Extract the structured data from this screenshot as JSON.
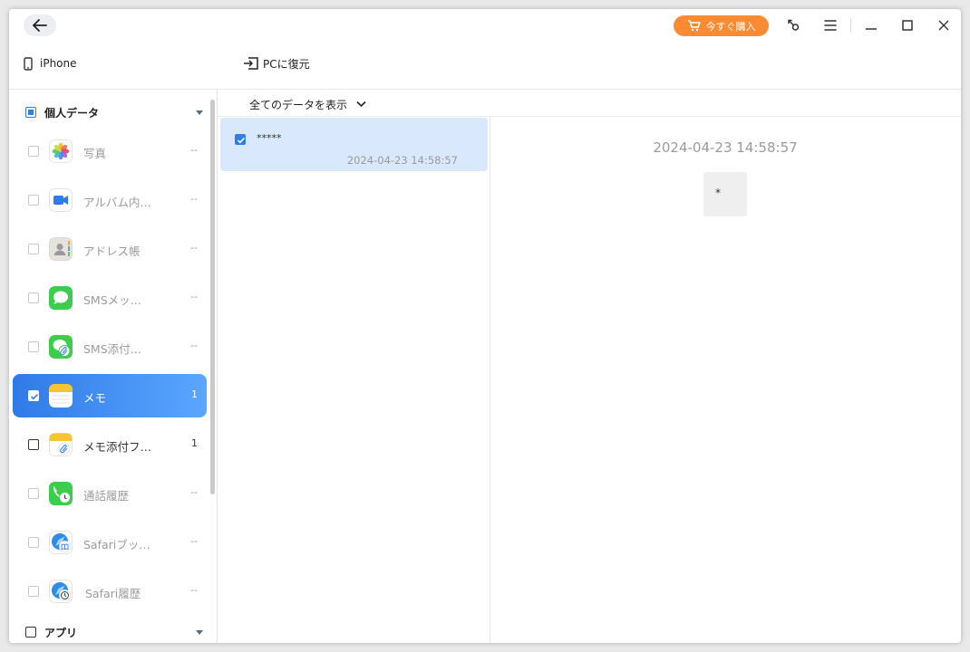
{
  "titlebar": {
    "buy_label": "今すぐ購入"
  },
  "toolbar": {
    "device_name": "iPhone",
    "restore_label": "PCに復元"
  },
  "sidebar": {
    "group_personal": "個人データ",
    "group_apps": "アプリ",
    "items": [
      {
        "label": "写真",
        "count": "--",
        "icon": "photos-icon"
      },
      {
        "label": "アルバム内…",
        "count": "--",
        "icon": "video-camera-icon"
      },
      {
        "label": "アドレス帳",
        "count": "--",
        "icon": "contacts-icon"
      },
      {
        "label": "SMSメッ…",
        "count": "--",
        "icon": "messages-icon"
      },
      {
        "label": "SMS添付…",
        "count": "--",
        "icon": "message-attachment-icon"
      },
      {
        "label": "メモ",
        "count": "1",
        "icon": "notes-icon"
      },
      {
        "label": "メモ添付フ…",
        "count": "1",
        "icon": "notes-attachment-icon"
      },
      {
        "label": "通話履歴",
        "count": "--",
        "icon": "call-history-icon"
      },
      {
        "label": "Safariブッ…",
        "count": "--",
        "icon": "safari-bookmark-icon"
      },
      {
        "label": "Safari履歴",
        "count": "--",
        "icon": "safari-history-icon"
      }
    ]
  },
  "list": {
    "filter_label": "全てのデータを表示",
    "notes": [
      {
        "title": "*****",
        "date": "2024-04-23 14:58:57"
      }
    ]
  },
  "detail": {
    "date": "2024-04-23 14:58:57",
    "content": "*"
  },
  "colors": {
    "accent": "#2f7ae8",
    "buy_button": "#fb8b33",
    "selected_row": "#d9e8fc"
  }
}
